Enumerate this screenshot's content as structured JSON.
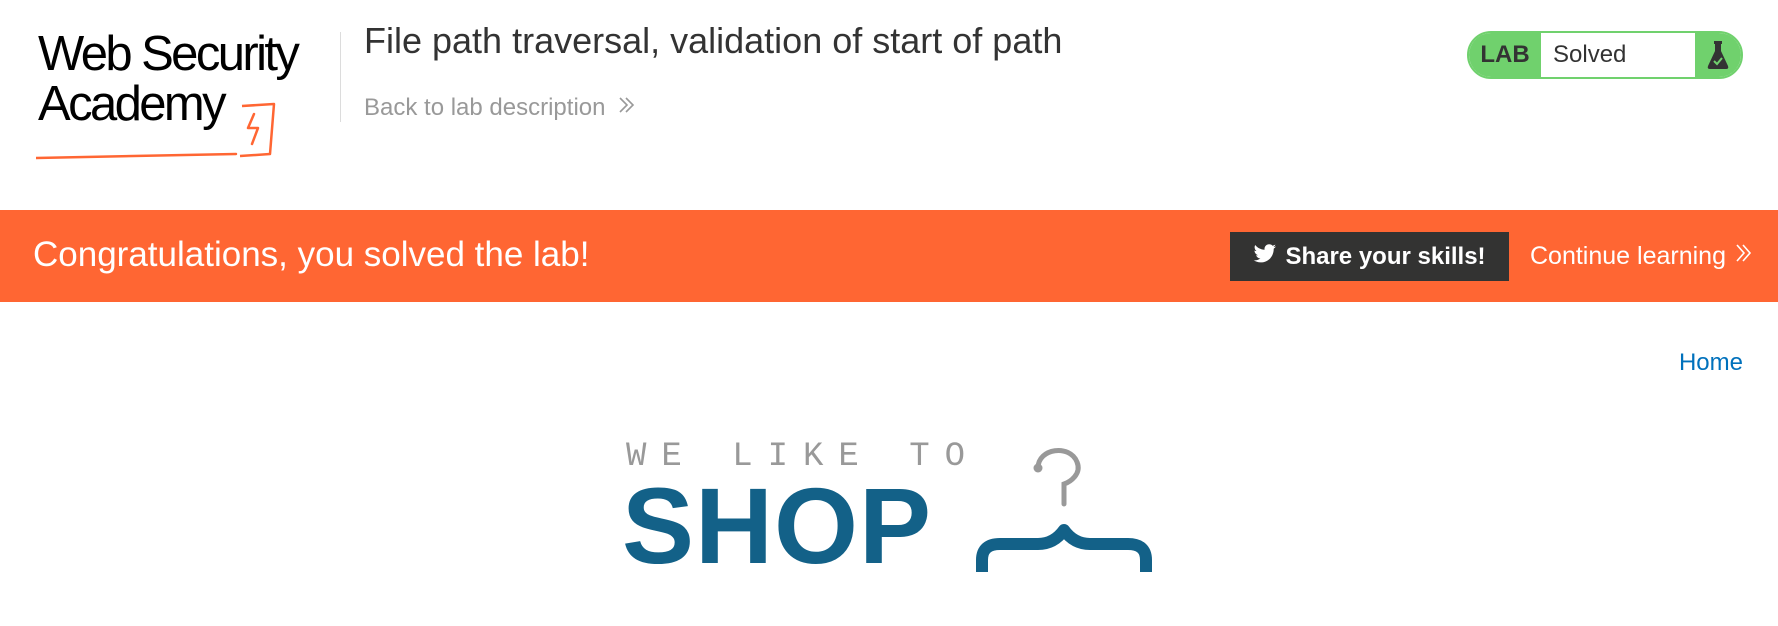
{
  "header": {
    "logo_line1": "Web Security",
    "logo_line2": "Academy",
    "lab_title": "File path traversal, validation of start of path",
    "back_link": "Back to lab description"
  },
  "lab_status": {
    "tag": "LAB",
    "state": "Solved",
    "accent": "#70d16d"
  },
  "banner": {
    "message": "Congratulations, you solved the lab!",
    "share_label": "Share your skills!",
    "continue_label": "Continue learning",
    "background": "#ff6633"
  },
  "nav": {
    "home": "Home"
  },
  "shop_logo": {
    "tagline": "WE LIKE TO",
    "word": "SHOP"
  }
}
